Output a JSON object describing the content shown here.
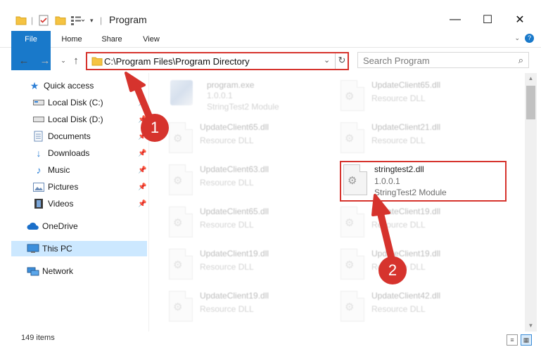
{
  "window": {
    "title": "Program",
    "minimize": "—",
    "maximize": "☐",
    "close": "✕"
  },
  "ribbon": {
    "tabs": [
      "File",
      "Home",
      "Share",
      "View"
    ]
  },
  "address": {
    "path": "C:\\Program Files\\Program Directory",
    "search_placeholder": "Search Program"
  },
  "nav": {
    "quick_access": "Quick access",
    "items": [
      {
        "label": "Local Disk (C:)",
        "pinned": true
      },
      {
        "label": "Local Disk (D:)",
        "pinned": true
      },
      {
        "label": "Documents",
        "pinned": true
      },
      {
        "label": "Downloads",
        "pinned": true
      },
      {
        "label": "Music",
        "pinned": true
      },
      {
        "label": "Pictures",
        "pinned": true
      },
      {
        "label": "Videos",
        "pinned": true
      }
    ],
    "onedrive": "OneDrive",
    "this_pc": "This PC",
    "network": "Network"
  },
  "files": [
    {
      "name": "program.exe",
      "line2": "1.0.0.1",
      "line3": "StringTest2 Module",
      "faded": true
    },
    {
      "name": "UpdateClient65.dll",
      "line2": "Resource DLL",
      "faded": true
    },
    {
      "name": "UpdateClient65.dll",
      "line2": "Resource DLL",
      "faded": true
    },
    {
      "name": "UpdateClient21.dll",
      "line2": "Resource DLL",
      "faded": true
    },
    {
      "name": "UpdateClient63.dll",
      "line2": "Resource DLL",
      "faded": true
    },
    {
      "name": "stringtest2.dll",
      "line2": "1.0.0.1",
      "line3": "StringTest2 Module",
      "faded": false
    },
    {
      "name": "UpdateClient65.dll",
      "line2": "Resource DLL",
      "faded": true
    },
    {
      "name": "UpdateClient19.dll",
      "line2": "Resource DLL",
      "faded": true
    },
    {
      "name": "UpdateClient19.dll",
      "line2": "Resource DLL",
      "faded": true
    },
    {
      "name": "UpdateClient19.dll",
      "line2": "Resource DLL",
      "faded": true
    },
    {
      "name": "UpdateClient19.dll",
      "line2": "Resource DLL",
      "faded": true
    },
    {
      "name": "UpdateClient42.dll",
      "line2": "Resource DLL",
      "faded": true
    }
  ],
  "annotations": {
    "step1": "1",
    "step2": "2",
    "color": "#d6332d"
  },
  "status": {
    "item_count": "149 items"
  },
  "icons": {
    "pin": "pin-icon",
    "gear": "gear-icon"
  }
}
